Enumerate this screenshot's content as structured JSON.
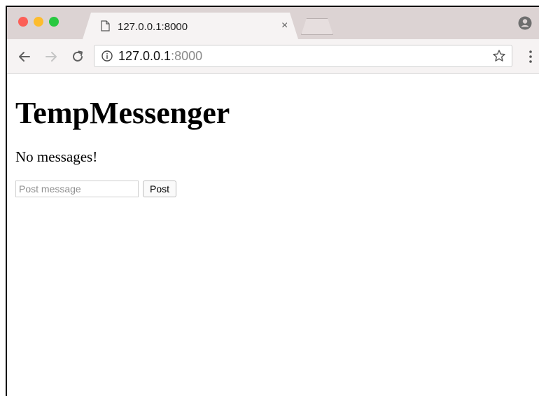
{
  "window": {
    "tab": {
      "title": "127.0.0.1:8000",
      "close": "×"
    },
    "address_bar": {
      "host": "127.0.0.1",
      "port": ":8000"
    },
    "icons": {
      "back": "back-arrow-icon",
      "forward": "forward-arrow-icon",
      "reload": "reload-icon",
      "info": "info-icon",
      "bookmark": "star-icon",
      "menu": "menu-dots-icon",
      "profile": "profile-icon",
      "page": "page-icon"
    },
    "traffic_lights": [
      "#fc5f57",
      "#fdbc2e",
      "#28c840"
    ]
  },
  "page": {
    "title": "TempMessenger",
    "status": "No messages!",
    "form": {
      "input_placeholder": "Post message",
      "input_value": "",
      "submit_label": "Post"
    }
  }
}
